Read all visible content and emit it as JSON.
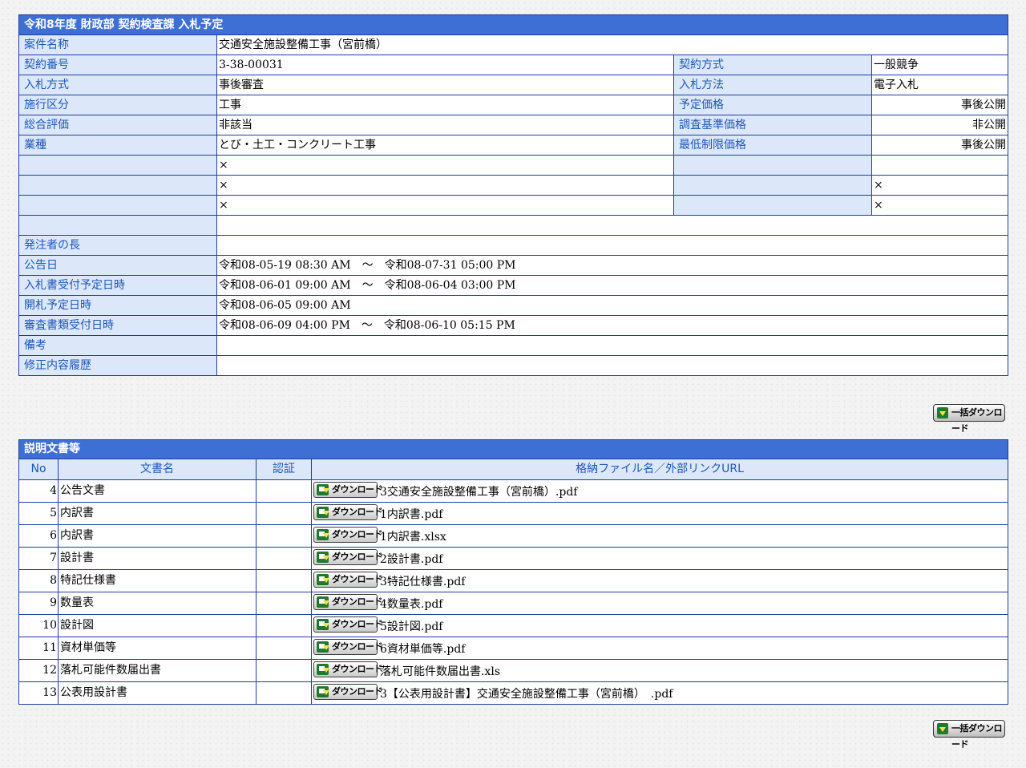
{
  "info": {
    "title": "令和8年度 財政部 契約検査課 入札予定",
    "rows": [
      {
        "label": "案件名称",
        "value": "交通安全施設整備工事（宮前橋）"
      },
      {
        "label": "契約番号",
        "value": "3-38-00031",
        "label2": "契約方式",
        "value2": "一般競争"
      },
      {
        "label": "入札方式",
        "value": "事後審査",
        "label2": "入札方法",
        "value2": "電子入札"
      },
      {
        "label": "施行区分",
        "value": "工事",
        "label2": "予定価格",
        "value2": "事後公開"
      },
      {
        "label": "総合評価",
        "value": "非該当",
        "label2": "調査基準価格",
        "value2": "非公開"
      },
      {
        "label": "業種",
        "value": "とび・土工・コンクリート工事",
        "label2": "最低制限価格",
        "value2": "事後公開"
      },
      {
        "label": "",
        "value": "×",
        "label2": "",
        "value2": ""
      },
      {
        "label": "",
        "value": "×",
        "label2": "",
        "value2": "×"
      },
      {
        "label": "",
        "value": "×",
        "label2": "",
        "value2": "×"
      },
      {
        "label": "",
        "value": ""
      },
      {
        "label": "発注者の長",
        "value": ""
      },
      {
        "label": "公告日",
        "value": "令和08-05-19 08:30 AM　～　令和08-07-31 05:00 PM"
      },
      {
        "label": "入札書受付予定日時",
        "value": "令和08-06-01 09:00 AM　～　令和08-06-04 03:00 PM"
      },
      {
        "label": "開札予定日時",
        "value": "令和08-06-05 09:00 AM"
      },
      {
        "label": "審査書類受付日時",
        "value": "令和08-06-09 04:00 PM　～　令和08-06-10 05:15 PM"
      },
      {
        "label": "備考",
        "value": ""
      },
      {
        "label": "修正内容履歴",
        "value": ""
      }
    ]
  },
  "bulk_download_label": "一括ダウンロード",
  "docs": {
    "title": "説明文書等",
    "headers": {
      "no": "No",
      "name": "文書名",
      "auth": "認証",
      "file": "格納ファイル名／外部リンクURL"
    },
    "download_label": "ダウンロード",
    "rows": [
      {
        "no": "4",
        "name": "公告文書",
        "auth": "",
        "file": "3交通安全施設整備工事（宮前橋）.pdf"
      },
      {
        "no": "5",
        "name": "内訳書",
        "auth": "",
        "file": "1内訳書.pdf"
      },
      {
        "no": "6",
        "name": "内訳書",
        "auth": "",
        "file": "1内訳書.xlsx"
      },
      {
        "no": "7",
        "name": "設計書",
        "auth": "",
        "file": "2設計書.pdf"
      },
      {
        "no": "8",
        "name": "特記仕様書",
        "auth": "",
        "file": "3特記仕様書.pdf"
      },
      {
        "no": "9",
        "name": "数量表",
        "auth": "",
        "file": "4数量表.pdf"
      },
      {
        "no": "10",
        "name": "設計図",
        "auth": "",
        "file": "5設計図.pdf"
      },
      {
        "no": "11",
        "name": "資材単価等",
        "auth": "",
        "file": "6資材単価等.pdf"
      },
      {
        "no": "12",
        "name": "落札可能件数届出書",
        "auth": "",
        "file": "落札可能件数届出書.xls"
      },
      {
        "no": "13",
        "name": "公表用設計書",
        "auth": "",
        "file": "3【公表用設計書】交通安全施設整備工事（宮前橋）　.pdf"
      }
    ]
  }
}
